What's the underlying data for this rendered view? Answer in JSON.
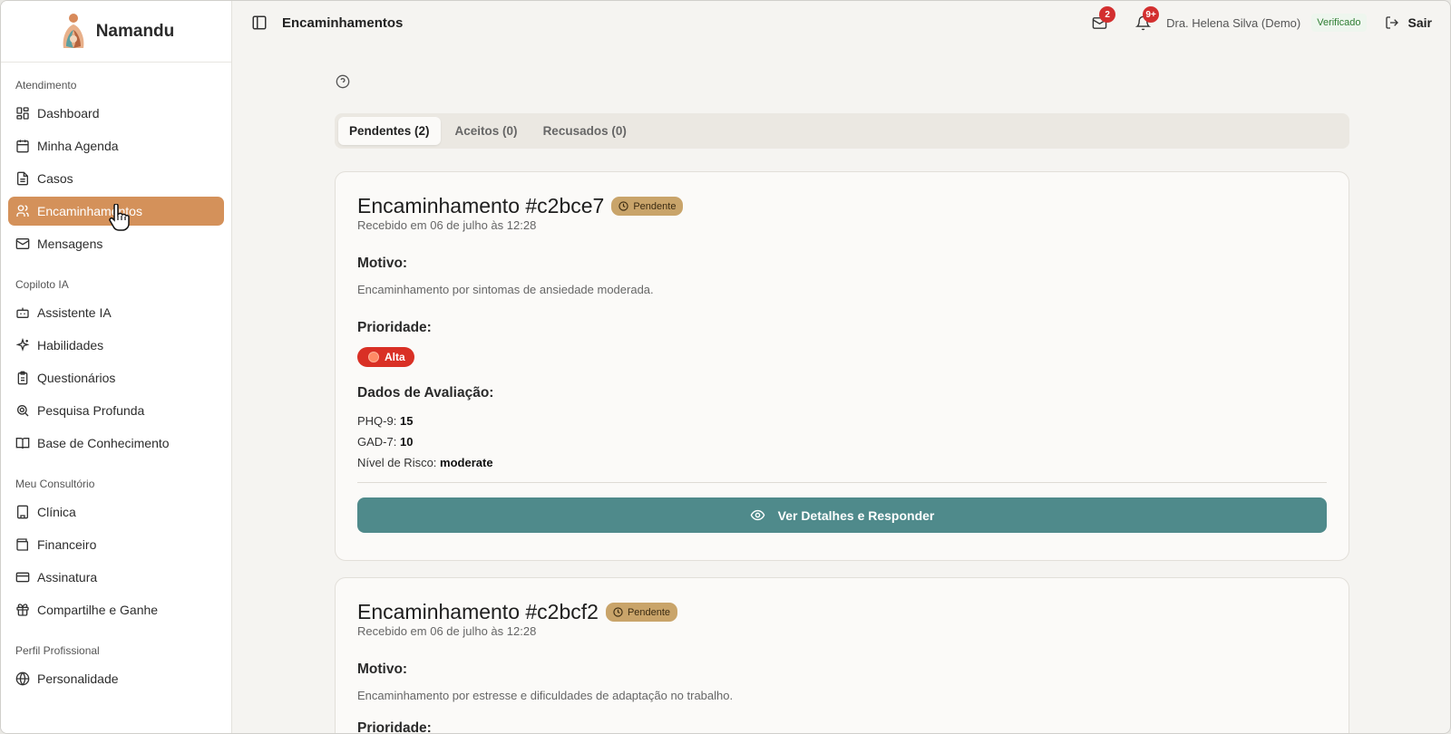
{
  "brand": {
    "name": "Namandu"
  },
  "header": {
    "title": "Encaminhamentos",
    "mail_count": "2",
    "notif_count": "9+",
    "user_name": "Dra. Helena Silva (Demo)",
    "verified_label": "Verificado",
    "logout_label": "Sair"
  },
  "sidebar": {
    "groups": [
      {
        "title": "Atendimento",
        "items": [
          "Dashboard",
          "Minha Agenda",
          "Casos",
          "Encaminhamentos",
          "Mensagens"
        ]
      },
      {
        "title": "Copiloto IA",
        "items": [
          "Assistente IA",
          "Habilidades",
          "Questionários",
          "Pesquisa Profunda",
          "Base de Conhecimento"
        ]
      },
      {
        "title": "Meu Consultório",
        "items": [
          "Clínica",
          "Financeiro",
          "Assinatura",
          "Compartilhe e Ganhe"
        ]
      },
      {
        "title": "Perfil Profissional",
        "items": [
          "Personalidade"
        ]
      }
    ],
    "active": "Encaminhamentos"
  },
  "tabs": [
    {
      "label": "Pendentes (2)",
      "active": true
    },
    {
      "label": "Aceitos (0)",
      "active": false
    },
    {
      "label": "Recusados (0)",
      "active": false
    }
  ],
  "cards": [
    {
      "title": "Encaminhamento #c2bce7",
      "status": "Pendente",
      "received": "Recebido em 06 de julho às 12:28",
      "motivo_label": "Motivo:",
      "motivo": "Encaminhamento por sintomas de ansiedade moderada.",
      "prioridade_label": "Prioridade:",
      "prioridade": "Alta",
      "avaliacao_label": "Dados de Avaliação:",
      "avaliacao": [
        {
          "key": "PHQ-9:",
          "value": "15"
        },
        {
          "key": "GAD-7:",
          "value": "10"
        },
        {
          "key": "Nível de Risco:",
          "value": "moderate"
        }
      ],
      "cta": "Ver Detalhes e Responder"
    },
    {
      "title": "Encaminhamento #c2bcf2",
      "status": "Pendente",
      "received": "Recebido em 06 de julho às 12:28",
      "motivo_label": "Motivo:",
      "motivo": "Encaminhamento por estresse e dificuldades de adaptação no trabalho.",
      "prioridade_label": "Prioridade:"
    }
  ],
  "colors": {
    "accent": "#d4915a",
    "cta": "#4f8a8b",
    "priority_high": "#d93025",
    "status_pending": "#c9a46a"
  }
}
